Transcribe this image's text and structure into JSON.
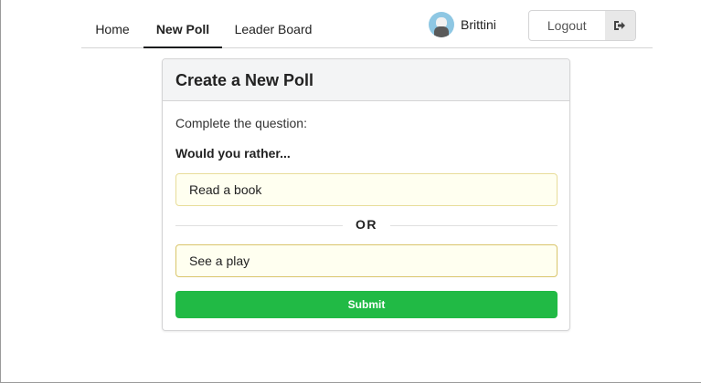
{
  "nav": {
    "tabs": [
      {
        "label": "Home",
        "active": false
      },
      {
        "label": "New Poll",
        "active": true
      },
      {
        "label": "Leader Board",
        "active": false
      }
    ],
    "user": {
      "name": "Brittini",
      "avatar_icon": "user-avatar"
    },
    "logout": {
      "label": "Logout",
      "icon": "sign-out-icon"
    }
  },
  "card": {
    "title": "Create a New Poll",
    "prompt": "Complete the question:",
    "question": "Would you rather...",
    "option_one": {
      "value": "Read a book"
    },
    "divider_text": "OR",
    "option_two": {
      "value": "See a play"
    },
    "submit_label": "Submit"
  },
  "colors": {
    "submit_green": "#21ba45",
    "option_background": "#fffff0",
    "header_background": "#f3f4f5"
  }
}
